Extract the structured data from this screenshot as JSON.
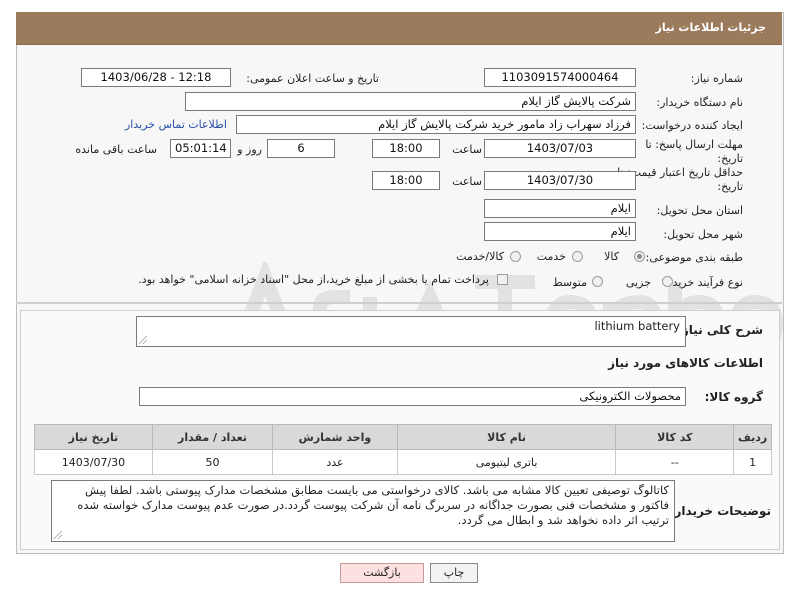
{
  "header": {
    "title": "جزئیات اطلاعات نیاز"
  },
  "fields": {
    "need_number_label": "شماره نیاز:",
    "need_number": "1103091574000464",
    "announce_label": "تاریخ و ساعت اعلان عمومی:",
    "announce_value": "1403/06/28 - 12:18",
    "buyer_org_label": "نام دستگاه خریدار:",
    "buyer_org": "شرکت پالایش گاز ایلام",
    "creator_label": "ایجاد کننده درخواست:",
    "creator": "فرزاد سهراب زاد مامور خرید شرکت پالایش گاز ایلام",
    "contact_link": "اطلاعات تماس خریدار",
    "deadline_label": "مهلت ارسال پاسخ: تا تاریخ:",
    "deadline_date": "1403/07/03",
    "time_label": "ساعت",
    "deadline_time": "18:00",
    "days_value": "6",
    "days_label": "روز و",
    "remaining_time": "05:01:14",
    "remaining_label": "ساعت باقی مانده",
    "price_validity_label": "حداقل تاریخ اعتبار قیمت: تا تاریخ:",
    "price_validity_date": "1403/07/30",
    "price_validity_time": "18:00",
    "province_label": "استان محل تحویل:",
    "province": "ایلام",
    "city_label": "شهر محل تحویل:",
    "city": "ایلام",
    "category_label": "طبقه بندی موضوعی:",
    "category_options": [
      "کالا",
      "خدمت",
      "کالا/خدمت"
    ],
    "process_label": "نوع فرآیند خرید :",
    "process_options": [
      "جزیی",
      "متوسط"
    ],
    "payment_note": "پرداخت تمام یا بخشی از مبلغ خرید،از محل \"اسناد خزانه اسلامی\" خواهد بود."
  },
  "description": {
    "label": "شرح کلی نیاز:",
    "value": "lithium battery"
  },
  "goods": {
    "section_title": "اطلاعات کالاهای مورد نیاز",
    "group_label": "گروه کالا:",
    "group_value": "محصولات الکترونیکی",
    "columns": [
      "ردیف",
      "کد کالا",
      "نام کالا",
      "واحد شمارش",
      "تعداد / مقدار",
      "تاریخ نیاز"
    ],
    "rows": [
      [
        "1",
        "--",
        "باتری لیتیومی",
        "عدد",
        "50",
        "1403/07/30"
      ]
    ]
  },
  "buyer_notes": {
    "label": "توضیحات خریدار:",
    "value": "کاتالوگ توصیفی تعیین کالا مشابه می باشد. کالای درخواستی می بایست مطابق مشخصات مدارک پیوستی باشد. لطفا پیش فاکتور و مشخصات فنی بصورت جداگانه در سربرگ نامه آن شرکت پیوست گردد.در صورت عدم پیوست مدارک خواسته شده ترتیب اثر داده نخواهد شد و ابطال می گردد."
  },
  "buttons": {
    "print": "چاپ",
    "back": "بازگشت"
  },
  "colors": {
    "header": "#9c7b5c",
    "link": "#2a4fa8",
    "back_button": "#fde0e0"
  }
}
